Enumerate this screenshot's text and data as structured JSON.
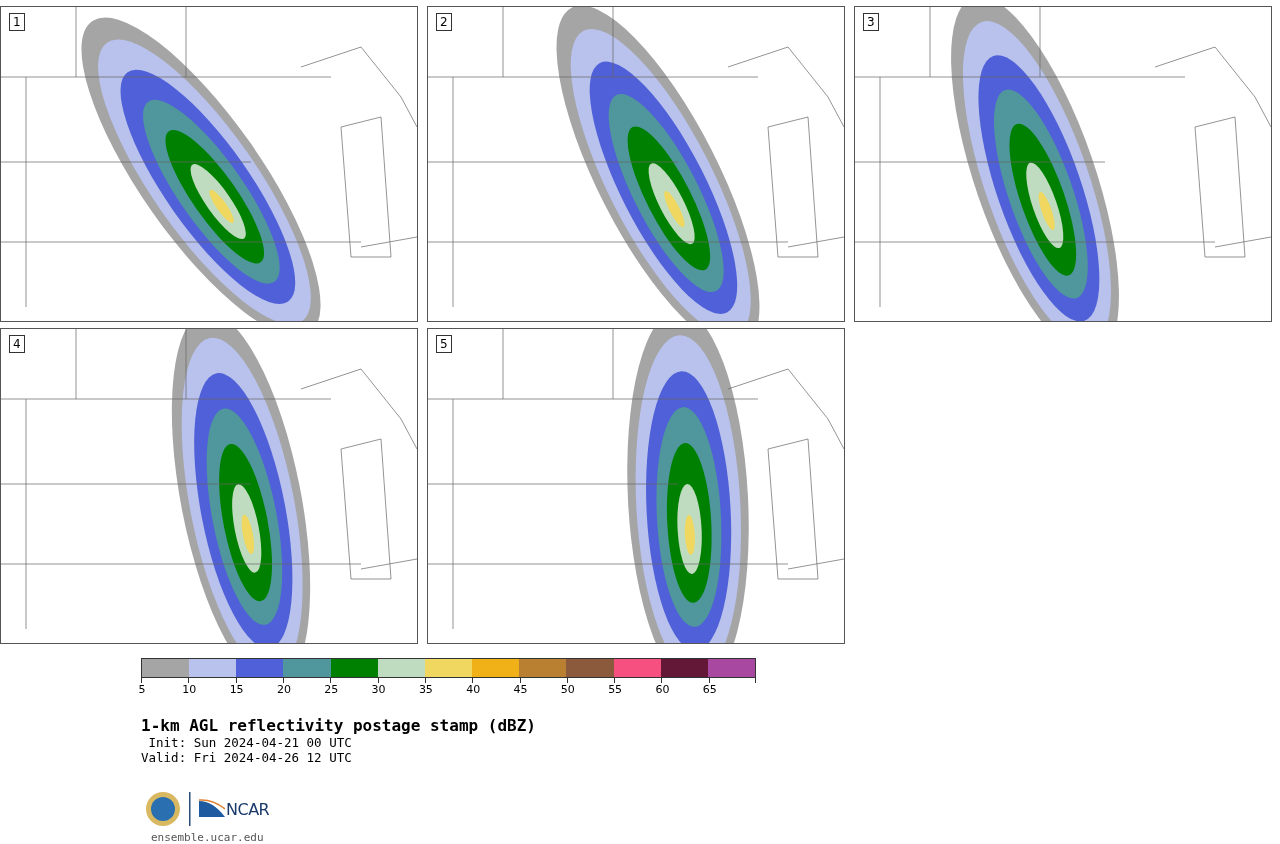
{
  "panels": [
    {
      "label": "1"
    },
    {
      "label": "2"
    },
    {
      "label": "3"
    },
    {
      "label": "4"
    },
    {
      "label": "5"
    }
  ],
  "colorbar": {
    "segments": [
      {
        "color": "#a5a5a5",
        "tick": "5"
      },
      {
        "color": "#b8c2ec",
        "tick": "10"
      },
      {
        "color": "#5060d8",
        "tick": "15"
      },
      {
        "color": "#4f979c",
        "tick": "20"
      },
      {
        "color": "#008000",
        "tick": "25"
      },
      {
        "color": "#c0dcc0",
        "tick": "30"
      },
      {
        "color": "#f0d860",
        "tick": "35"
      },
      {
        "color": "#f0b018",
        "tick": "40"
      },
      {
        "color": "#b88030",
        "tick": "45"
      },
      {
        "color": "#8b5a3c",
        "tick": "50"
      },
      {
        "color": "#f55080",
        "tick": "55"
      },
      {
        "color": "#641838",
        "tick": "60"
      },
      {
        "color": "#a848a0",
        "tick": "65"
      }
    ]
  },
  "title": "1-km AGL reflectivity postage stamp (dBZ)",
  "init": " Init: Sun 2024-04-21 00 UTC",
  "valid": "Valid: Fri 2024-04-26 12 UTC",
  "logo": {
    "wordmark": "NCAR"
  },
  "site": "ensemble.ucar.edu"
}
